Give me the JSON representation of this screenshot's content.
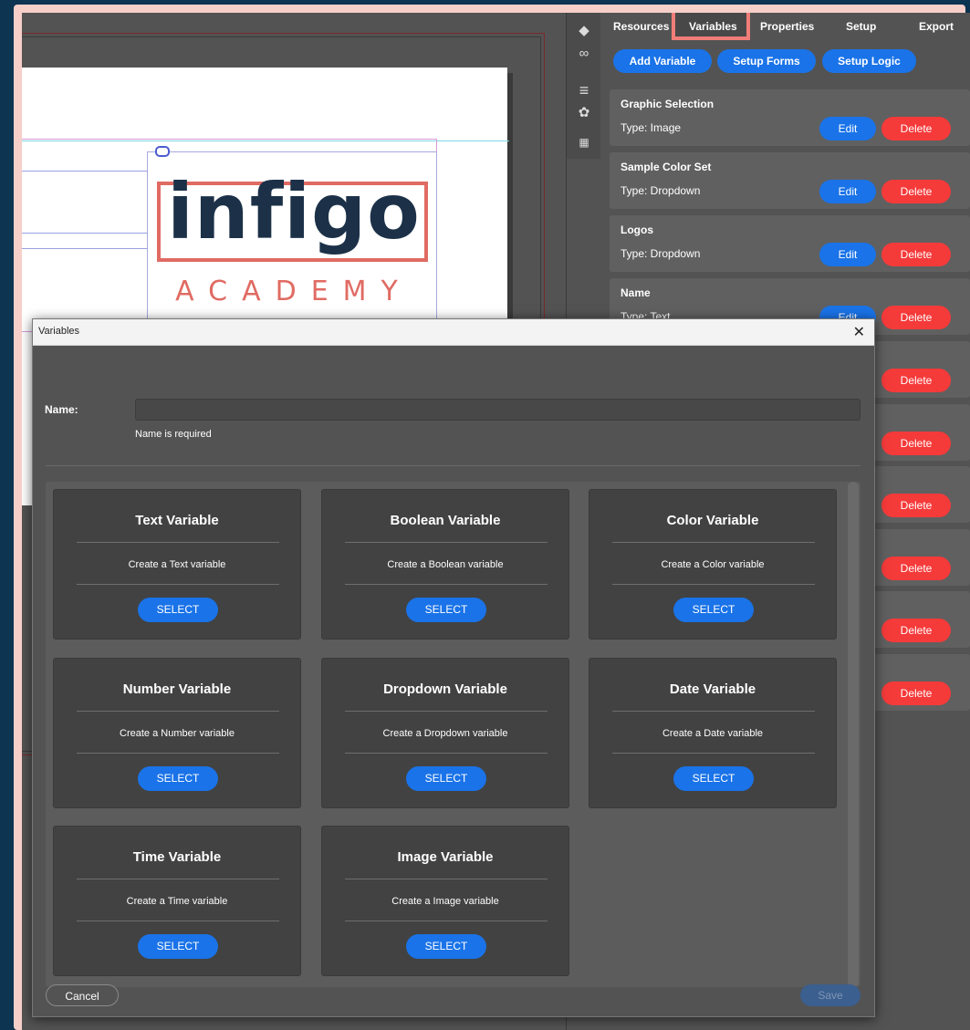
{
  "canvas": {
    "logo": {
      "word": "infigo",
      "subtitle": "ACADEMY"
    }
  },
  "toolbar": {
    "icons": [
      "layers-icon",
      "link-icon",
      "align-icon",
      "palette-icon",
      "grid-icon"
    ]
  },
  "panel": {
    "tabs": [
      "Resources",
      "Variables",
      "Properties",
      "Setup",
      "Export"
    ],
    "active_tab": "Variables",
    "actions": {
      "add_variable": "Add Variable",
      "setup_forms": "Setup Forms",
      "setup_logic": "Setup Logic"
    },
    "variables": [
      {
        "name": "Graphic Selection",
        "type": "Type: Image"
      },
      {
        "name": "Sample Color Set",
        "type": "Type: Dropdown"
      },
      {
        "name": "Logos",
        "type": "Type: Dropdown"
      },
      {
        "name": "Name",
        "type": "Type: Text"
      }
    ],
    "edit_label": "Edit",
    "delete_label": "Delete"
  },
  "dialog": {
    "title": "Variables",
    "close_glyph": "✕",
    "name_label": "Name:",
    "name_value": "",
    "name_error": "Name is required",
    "types": [
      {
        "title": "Text Variable",
        "desc": "Create a Text variable"
      },
      {
        "title": "Boolean Variable",
        "desc": "Create a Boolean variable"
      },
      {
        "title": "Color Variable",
        "desc": "Create a Color variable"
      },
      {
        "title": "Number Variable",
        "desc": "Create a Number variable"
      },
      {
        "title": "Dropdown Variable",
        "desc": "Create a Dropdown variable"
      },
      {
        "title": "Date Variable",
        "desc": "Create a Date variable"
      },
      {
        "title": "Time Variable",
        "desc": "Create a Time variable"
      },
      {
        "title": "Image Variable",
        "desc": "Create a Image variable"
      }
    ],
    "select_label": "SELECT",
    "cancel_label": "Cancel",
    "save_label": "Save"
  },
  "colors": {
    "accent_blue": "#1a73e8",
    "delete_red": "#f53a3a",
    "highlight": "#f07d78",
    "logo_navy": "#1c3148",
    "logo_coral": "#e06b63"
  }
}
